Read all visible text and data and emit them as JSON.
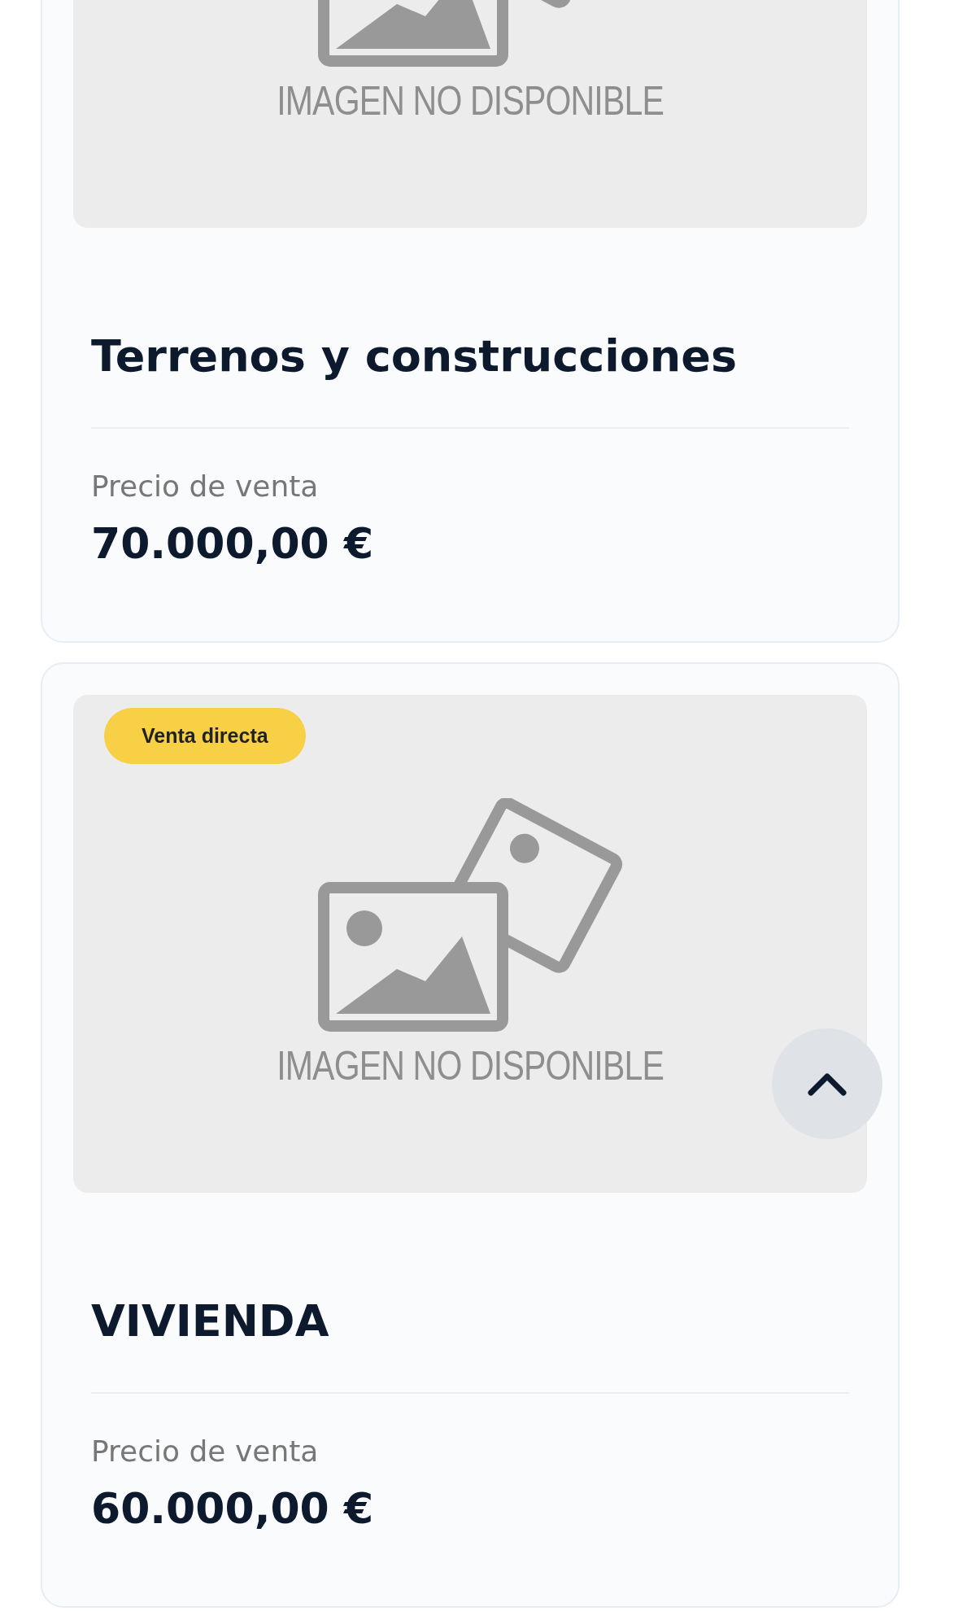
{
  "listings": [
    {
      "image_text": "IMAGEN NO DISPONIBLE",
      "title": "Terrenos y construcciones",
      "price_label": "Precio de venta",
      "price": "70.000,00 €"
    },
    {
      "badge": "Venta directa",
      "image_text": "IMAGEN NO DISPONIBLE",
      "title": "VIVIENDA",
      "price_label": "Precio de venta",
      "price": "60.000,00 €"
    }
  ]
}
